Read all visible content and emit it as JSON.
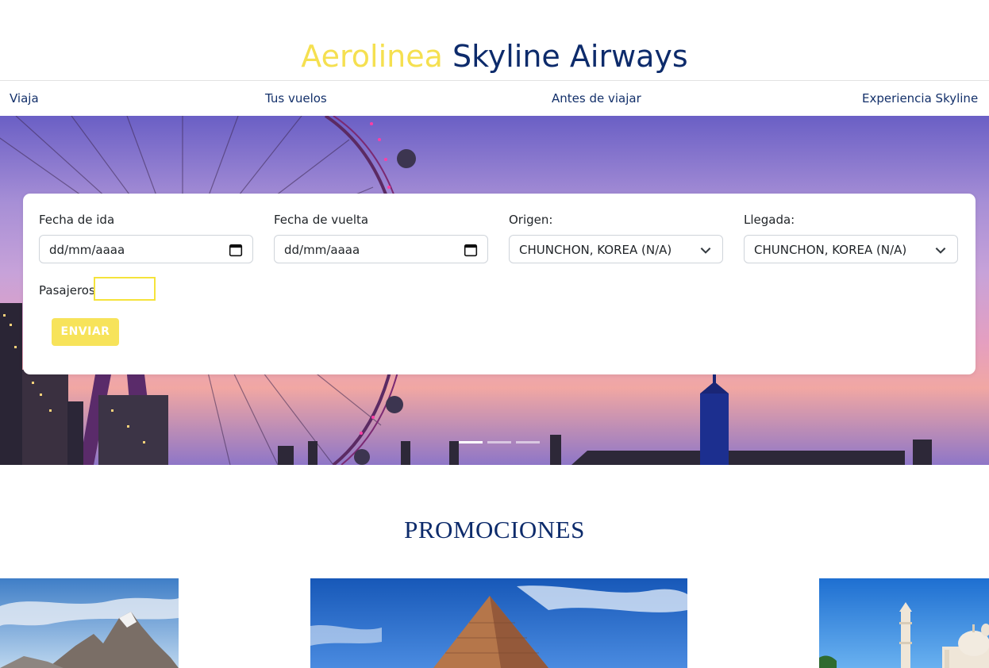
{
  "brand": {
    "word1": "Aerolinea",
    "word2": "Skyline Airways"
  },
  "nav": [
    "Viaja",
    "Tus vuelos",
    "Antes de viajar",
    "Experiencia Skyline"
  ],
  "form": {
    "fecha_ida_label": "Fecha de ida",
    "fecha_ida_value": "dd/mm/aaaa",
    "fecha_vuelta_label": "Fecha de vuelta",
    "fecha_vuelta_value": "dd/mm/aaaa",
    "origen_label": "Origen:",
    "origen_value": "CHUNCHON, KOREA (N/A)",
    "llegada_label": "Llegada:",
    "llegada_value": "CHUNCHON, KOREA (N/A)",
    "pasajeros_label": "Pasajeros",
    "pasajeros_value": "",
    "submit_label": "ENVIAR"
  },
  "carousel": {
    "slides": 3,
    "active": 0
  },
  "promotions": {
    "title": "PROMOCIONES"
  },
  "colors": {
    "brand_yellow": "#f5e050",
    "brand_navy": "#0d2b6b",
    "button_yellow": "#f7e35a"
  }
}
